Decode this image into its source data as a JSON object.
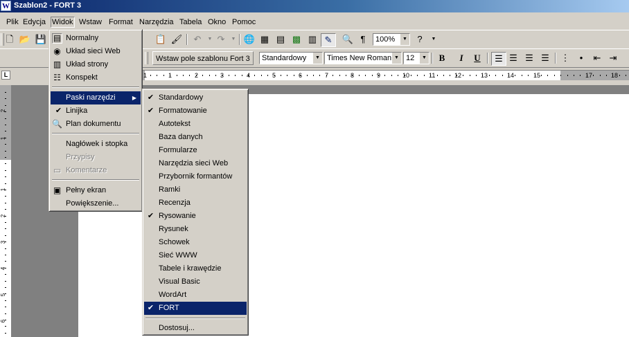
{
  "window": {
    "title": "Szablon2 - FORT 3",
    "app_icon": "W"
  },
  "menubar": [
    {
      "label": "Plik"
    },
    {
      "label": "Edycja"
    },
    {
      "label": "Widok"
    },
    {
      "label": "Wstaw"
    },
    {
      "label": "Format"
    },
    {
      "label": "Narzędzia"
    },
    {
      "label": "Tabela"
    },
    {
      "label": "Okno"
    },
    {
      "label": "Pomoc"
    }
  ],
  "standard_toolbar": {
    "zoom": "100%",
    "icons": [
      "new-icon",
      "open-icon",
      "save-icon",
      "paste-icon",
      "format-painter-icon",
      "undo-icon",
      "redo-icon",
      "hyperlink-icon",
      "tables-borders-icon",
      "insert-table-icon",
      "insert-excel-icon",
      "columns-icon",
      "drawing-icon",
      "document-map-icon",
      "show-hide-icon",
      "help-icon"
    ]
  },
  "formatting_toolbar": {
    "insert_field_button": "Wstaw pole szablonu Fort 3",
    "style": "Standardowy",
    "font": "Times New Roman",
    "size": "12",
    "bold": "B",
    "italic": "I",
    "underline": "U"
  },
  "ruler": {
    "tab_selector": "L",
    "h_numbers": [
      "1",
      "1",
      "2",
      "3",
      "4",
      "5",
      "6",
      "7",
      "8",
      "9",
      "10",
      "11",
      "12",
      "13",
      "14",
      "15",
      "17",
      "18"
    ],
    "v_numbers": [
      "2",
      "1",
      "1",
      "2",
      "3",
      "4",
      "5",
      "6"
    ]
  },
  "view_menu": {
    "items": [
      {
        "label": "Normalny",
        "icon": "normal-view-icon",
        "checked": true
      },
      {
        "label": "Układ sieci Web",
        "icon": "web-layout-icon"
      },
      {
        "label": "Układ strony",
        "icon": "print-layout-icon"
      },
      {
        "label": "Konspekt",
        "icon": "outline-icon"
      },
      {
        "label": "Paski narzędzi",
        "submenu": true,
        "highlighted": true
      },
      {
        "label": "Linijka",
        "checkmark": true
      },
      {
        "label": "Plan dokumentu",
        "icon": "document-map-icon"
      },
      {
        "label": "Nagłówek i stopka"
      },
      {
        "label": "Przypisy",
        "disabled": true
      },
      {
        "label": "Komentarze",
        "icon": "comments-icon",
        "disabled": true
      },
      {
        "label": "Pełny ekran",
        "icon": "full-screen-icon"
      },
      {
        "label": "Powiększenie..."
      }
    ]
  },
  "toolbars_submenu": {
    "items": [
      {
        "label": "Standardowy",
        "checked": true
      },
      {
        "label": "Formatowanie",
        "checked": true
      },
      {
        "label": "Autotekst"
      },
      {
        "label": "Baza danych"
      },
      {
        "label": "Formularze"
      },
      {
        "label": "Narzędzia sieci Web"
      },
      {
        "label": "Przybornik formantów"
      },
      {
        "label": "Ramki"
      },
      {
        "label": "Recenzja"
      },
      {
        "label": "Rysowanie",
        "checked": true
      },
      {
        "label": "Rysunek"
      },
      {
        "label": "Schowek"
      },
      {
        "label": "Sieć WWW"
      },
      {
        "label": "Tabele i krawędzie"
      },
      {
        "label": "Visual Basic"
      },
      {
        "label": "WordArt"
      },
      {
        "label": "FORT",
        "checked": true,
        "highlighted": true
      },
      {
        "label": "Dostosuj..."
      }
    ]
  },
  "colors": {
    "highlight": "#0a246a",
    "face": "#d4d0c8",
    "workspace": "#808080"
  }
}
